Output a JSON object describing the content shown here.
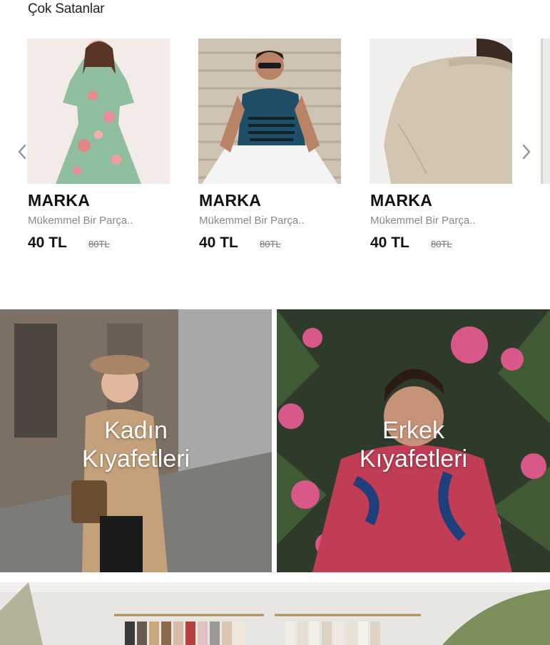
{
  "section_title": "Çok Satanlar",
  "products": [
    {
      "brand": "MARKA",
      "description": "Mükemmel Bir Parça..",
      "price": "40 TL",
      "old_price": "80TL"
    },
    {
      "brand": "MARKA",
      "description": "Mükemmel Bir Parça..",
      "price": "40 TL",
      "old_price": "80TL"
    },
    {
      "brand": "MARKA",
      "description": "Mükemmel Bir Parça..",
      "price": "40 TL",
      "old_price": "80TL"
    }
  ],
  "categories": [
    {
      "line1": "Kadın",
      "line2": "Kıyafetleri"
    },
    {
      "line1": "Erkek",
      "line2": "Kıyafetleri"
    }
  ],
  "icons": {
    "prev": "chevron-left-icon",
    "next": "chevron-right-icon"
  }
}
